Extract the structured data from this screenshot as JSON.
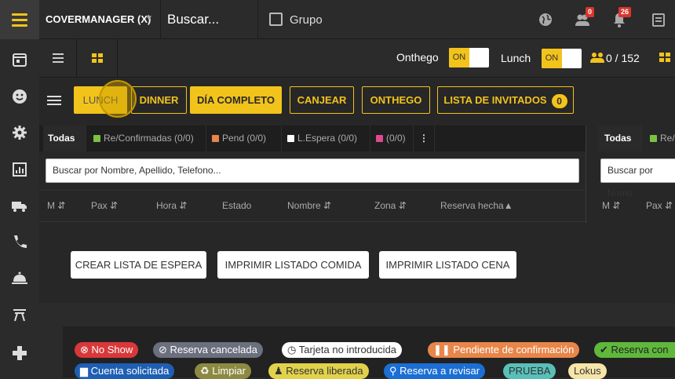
{
  "topbar": {
    "brand": "COVERMANAGER (X)",
    "search_text": "Buscar...",
    "grupo_label": "Grupo",
    "badges": {
      "people": "0",
      "bell": "26"
    },
    "icons": [
      "globe-icon",
      "users-icon",
      "bell-icon",
      "calendar-list-icon"
    ]
  },
  "sidebar": {
    "icons": [
      "calendar-icon",
      "smile-icon",
      "gear-icon",
      "bar-chart-icon",
      "truck-icon",
      "phone-icon",
      "cloche-icon",
      "table-icon",
      "gamepad-icon"
    ]
  },
  "bar2": {
    "onthego_label": "Onthego",
    "lunch_label": "Lunch",
    "toggle_on": "ON",
    "capacity": "0 / 152"
  },
  "service_buttons": {
    "lunch": "LUNCH",
    "dinner": "DINNER",
    "full_day": "DÍA COMPLETO",
    "redeem": "CANJEAR",
    "onthego": "ONTHEGO",
    "guest_list": "LISTA DE INVITADOS",
    "guest_list_count": "0"
  },
  "tabs": {
    "all": "Todas",
    "confirmed": "Re/Confirmadas (0/0)",
    "pending": "Pend (0/0)",
    "waitlist": "L.Espera (0/0)",
    "other": "(0/0)",
    "more": "⋮",
    "right_all": "Todas",
    "right_confirmed": "Re/"
  },
  "colors": {
    "accent": "#f2c31b",
    "confirmed": "#7cc142",
    "pending": "#e8864a",
    "waitlist": "#ffffff",
    "other": "#e0498f"
  },
  "search": {
    "placeholder": "Buscar por Nombre, Apellido, Telefono...",
    "right_placeholder": "Buscar por Nomb"
  },
  "columns": [
    "M",
    "Pax",
    "Hora",
    "Estado",
    "Nombre",
    "Zona",
    "Reserva hecha"
  ],
  "columns_right": [
    "M",
    "Pax"
  ],
  "actions": {
    "waitlist": "CREAR LISTA DE ESPERA",
    "print_lunch": "IMPRIMIR LISTADO COMIDA",
    "print_dinner": "IMPRIMIR LISTADO CENA"
  },
  "legend": [
    {
      "label": "No Show",
      "icon": "x-circle-icon",
      "color": "#d9383a"
    },
    {
      "label": "Reserva cancelada",
      "icon": "ban-icon",
      "color": "#6c6f7d"
    },
    {
      "label": "Tarjeta no introducida",
      "icon": "clock-icon",
      "color": "#ffffff"
    },
    {
      "label": "Pendiente de confirmación",
      "icon": "pause-icon",
      "color": "#e8864a"
    },
    {
      "label": "Reserva con",
      "icon": "check-icon",
      "color": "#5fb83c"
    },
    {
      "label": "Cuenta solicitada",
      "icon": "receipt-icon",
      "color": "#1e5fb4"
    },
    {
      "label": "Limpiar",
      "icon": "recycle-icon",
      "color": "#8c8a42"
    },
    {
      "label": "Reserva liberada",
      "icon": "person-icon",
      "color": "#e2d24b"
    },
    {
      "label": "Reserva a revisar",
      "icon": "search-icon",
      "color": "#1b6fd4"
    },
    {
      "label": "PRUEBA",
      "icon": "",
      "color": "#58c0b8"
    },
    {
      "label": "Lokus",
      "icon": "",
      "color": "#f6e5a8"
    }
  ]
}
